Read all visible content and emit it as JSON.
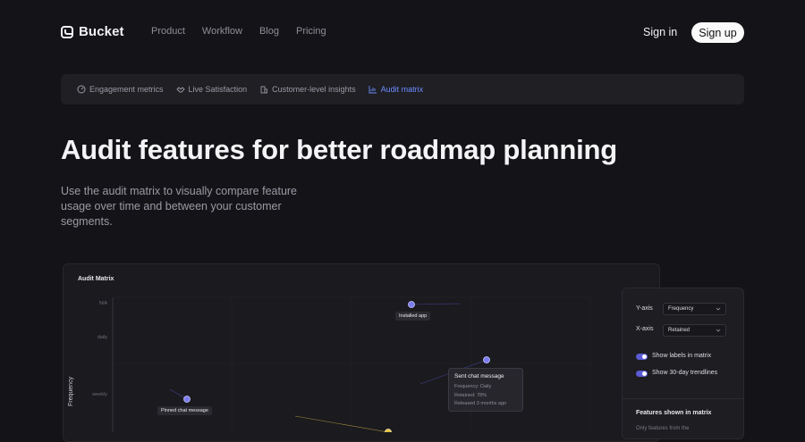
{
  "header": {
    "brand": "Bucket",
    "nav": [
      "Product",
      "Workflow",
      "Blog",
      "Pricing"
    ],
    "sign_in": "Sign in",
    "sign_up": "Sign up"
  },
  "tabs": [
    {
      "label": "Engagement metrics",
      "icon": "gauge-icon",
      "active": false
    },
    {
      "label": "Live Satisfaction",
      "icon": "handshake-icon",
      "active": false
    },
    {
      "label": "Customer-level insights",
      "icon": "building-icon",
      "active": false
    },
    {
      "label": "Audit matrix",
      "icon": "chart-icon",
      "active": true
    }
  ],
  "hero": {
    "title": "Audit features for better roadmap planning",
    "subtitle": "Use the audit matrix to visually compare feature usage over time and between your customer segments."
  },
  "audit_card": {
    "title": "Audit Matrix",
    "y_axis_label": "Frequency",
    "y_ticks": [
      "N/A",
      "daily",
      "weekly"
    ],
    "points": [
      {
        "label": "Installed app",
        "color": "#7c7cf0"
      },
      {
        "label": "Sent chat message",
        "color": "#7c7cf0"
      },
      {
        "label": "Pinned chat message",
        "color": "#7c7cf0"
      },
      {
        "label": "",
        "color": "#e2c146"
      }
    ],
    "tooltip": {
      "title": "Sent chat message",
      "frequency": "Frequency: Daily",
      "retained": "Retained: 78%",
      "released": "Released 3 months ago"
    }
  },
  "panel": {
    "y_axis_label": "Y-axis",
    "y_axis_value": "Frequency",
    "x_axis_label": "X-axis",
    "x_axis_value": "Retained",
    "toggle_labels": "Show labels in matrix",
    "toggle_trendlines": "Show 30-day trendlines",
    "labels_on": true,
    "trendlines_on": true,
    "features_title": "Features shown in matrix",
    "features_sub": "Only features from the"
  },
  "colors": {
    "accent": "#6e8cff",
    "toggle": "#5b5bd6",
    "background": "#141418"
  }
}
